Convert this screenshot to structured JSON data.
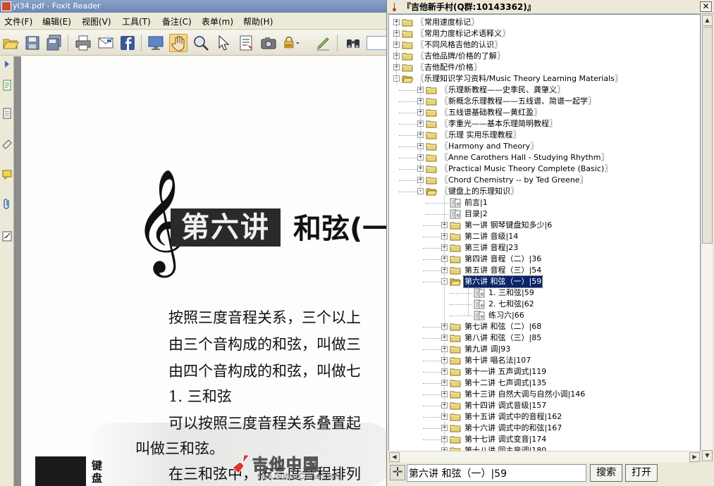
{
  "foxit": {
    "title": "yl34.pdf - Foxit Reader",
    "menu": [
      "文件(F)",
      "编辑(E)",
      "视图(V)",
      "工具(T)",
      "备注(C)",
      "表单(m)",
      "帮助(H)"
    ],
    "page": {
      "chapter_badge": "第六讲",
      "chapter_title": "和弦(一",
      "lines": [
        "按照三度音程关系，三个以上",
        "由三个音构成的和弦，叫做三",
        "由四个音构成的和弦，叫做七",
        "1. 三和弦",
        "可以按照三度音程关系叠置起",
        "叫做三和弦。",
        "在三和弦中，按三度音程排列"
      ],
      "side_char": "键盘"
    }
  },
  "tree_window": {
    "title": "『吉他新手村(Q群:10143362)』",
    "close": "✕",
    "nodes": [
      {
        "label": "〖常用速度标记〗",
        "level": 0,
        "type": "folder",
        "toggle": "+"
      },
      {
        "label": "〖常用力度标记术语释义〗",
        "level": 0,
        "type": "folder",
        "toggle": "+"
      },
      {
        "label": "〖不同风格吉他的认识〗",
        "level": 0,
        "type": "folder",
        "toggle": "+"
      },
      {
        "label": "〖吉他品牌/价格的了解〗",
        "level": 0,
        "type": "folder",
        "toggle": "+"
      },
      {
        "label": "〖吉他配件/价格〗",
        "level": 0,
        "type": "folder",
        "toggle": "+"
      },
      {
        "label": "〖乐理知识学习资料/Music Theory Learning Materials〗",
        "level": 0,
        "type": "folder-open",
        "toggle": "-"
      },
      {
        "label": "〖乐理新教程——史季民、龚肇义〗",
        "level": 1,
        "type": "folder",
        "toggle": "+"
      },
      {
        "label": "〖新概念乐理教程——五线谱、简谱一起学〗",
        "level": 1,
        "type": "folder",
        "toggle": "+"
      },
      {
        "label": "〖五线谱基础教程—黄红盈〗",
        "level": 1,
        "type": "folder",
        "toggle": "+"
      },
      {
        "label": "〖李重光——基本乐理简明教程〗",
        "level": 1,
        "type": "folder",
        "toggle": "+"
      },
      {
        "label": "〖乐理 实用乐理教程〗",
        "level": 1,
        "type": "folder",
        "toggle": "+"
      },
      {
        "label": "〖Harmony and Theory〗",
        "level": 1,
        "type": "folder",
        "toggle": "+"
      },
      {
        "label": "〖Anne Carothers Hall - Studying Rhythm〗",
        "level": 1,
        "type": "folder",
        "toggle": "+"
      },
      {
        "label": "〖Practical Music Theory Complete (Basic)〗",
        "level": 1,
        "type": "folder",
        "toggle": "+"
      },
      {
        "label": "〖Chord Chemistry -- by Ted Greene〗",
        "level": 1,
        "type": "folder",
        "toggle": "+"
      },
      {
        "label": "〖键盘上的乐理知识〗",
        "level": 1,
        "type": "folder-open",
        "toggle": "-"
      },
      {
        "label": "前言|1",
        "level": 2,
        "type": "doc",
        "toggle": ""
      },
      {
        "label": "目录|2",
        "level": 2,
        "type": "doc",
        "toggle": ""
      },
      {
        "label": "第一讲 钢琴键盘知多少|6",
        "level": 2,
        "type": "folder",
        "toggle": "+"
      },
      {
        "label": "第二讲 音级|14",
        "level": 2,
        "type": "folder",
        "toggle": "+"
      },
      {
        "label": "第三讲 音程|23",
        "level": 2,
        "type": "folder",
        "toggle": "+"
      },
      {
        "label": "第四讲 音程（二）|36",
        "level": 2,
        "type": "folder",
        "toggle": "+"
      },
      {
        "label": "第五讲 音程（三）|54",
        "level": 2,
        "type": "folder",
        "toggle": "+"
      },
      {
        "label": "第六讲 和弦（一）|59",
        "level": 2,
        "type": "folder-open",
        "toggle": "-",
        "selected": true
      },
      {
        "label": "1. 三和弦|59",
        "level": 3,
        "type": "doc",
        "toggle": ""
      },
      {
        "label": "2. 七和弦|62",
        "level": 3,
        "type": "doc",
        "toggle": ""
      },
      {
        "label": "练习六|66",
        "level": 3,
        "type": "doc",
        "toggle": ""
      },
      {
        "label": "第七讲 和弦（二）|68",
        "level": 2,
        "type": "folder",
        "toggle": "+"
      },
      {
        "label": "第八讲 和弦（三）|85",
        "level": 2,
        "type": "folder",
        "toggle": "+"
      },
      {
        "label": "第九讲 调|93",
        "level": 2,
        "type": "folder",
        "toggle": "+"
      },
      {
        "label": "第十讲 唱名法|107",
        "level": 2,
        "type": "folder",
        "toggle": "+"
      },
      {
        "label": "第十一讲 五声调式|119",
        "level": 2,
        "type": "folder",
        "toggle": "+"
      },
      {
        "label": "第十二讲 七声调式|135",
        "level": 2,
        "type": "folder",
        "toggle": "+"
      },
      {
        "label": "第十三讲 自然大调与自然小调|146",
        "level": 2,
        "type": "folder",
        "toggle": "+"
      },
      {
        "label": "第十四讲 调式音级|157",
        "level": 2,
        "type": "folder",
        "toggle": "+"
      },
      {
        "label": "第十五讲 调式中的音程|162",
        "level": 2,
        "type": "folder",
        "toggle": "+"
      },
      {
        "label": "第十六讲 调式中的和弦|167",
        "level": 2,
        "type": "folder",
        "toggle": "+"
      },
      {
        "label": "第十七讲 调式变音|174",
        "level": 2,
        "type": "folder",
        "toggle": "+"
      },
      {
        "label": "第十八讲 同主音调|180",
        "level": 2,
        "type": "folder",
        "toggle": "+"
      }
    ],
    "search": {
      "value": "第六讲 和弦（一）|59",
      "button": "搜索",
      "button2": "打开"
    },
    "watermark": {
      "text": "吉他中国",
      "url": "bbs.GuitarChina.com"
    }
  },
  "colors": {
    "selection": "#0a246a",
    "folder": "#e8d27a",
    "title_active": "#6d87b5"
  }
}
